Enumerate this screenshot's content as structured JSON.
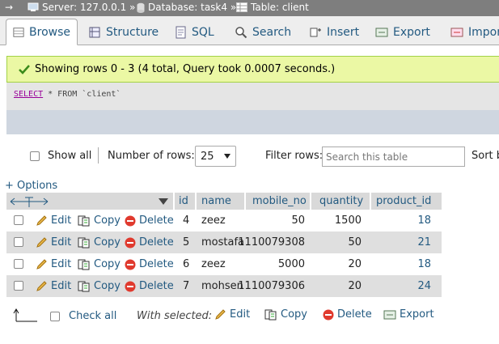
{
  "breadcrumb": {
    "arrow": "→",
    "server": "Server: 127.0.0.1 »",
    "database": "Database: task4 »",
    "table": "Table: client"
  },
  "tabs": [
    {
      "label": "Browse",
      "icon": "browse-icon"
    },
    {
      "label": "Structure",
      "icon": "structure-icon"
    },
    {
      "label": "SQL",
      "icon": "sql-icon"
    },
    {
      "label": "Search",
      "icon": "search-icon"
    },
    {
      "label": "Insert",
      "icon": "insert-icon"
    },
    {
      "label": "Export",
      "icon": "export-icon"
    },
    {
      "label": "Impor",
      "icon": "import-icon"
    }
  ],
  "success_message": "Showing rows 0 - 3 (4 total, Query took 0.0007 seconds.)",
  "sql": {
    "keyword": "SELECT",
    "rest": " * FROM `client`"
  },
  "nav": {
    "show_all": "Show all",
    "number_of_rows_label": "Number of rows:",
    "rows_value": "25",
    "filter_label": "Filter rows:",
    "filter_placeholder": "Search this table",
    "sort_label": "Sort b"
  },
  "options_link": "+ Options",
  "table": {
    "columns": [
      "id",
      "name",
      "mobile_no",
      "quantity",
      "product_id"
    ],
    "actions": {
      "edit": "Edit",
      "copy": "Copy",
      "delete": "Delete"
    },
    "rows": [
      {
        "id": "4",
        "name": "zeez",
        "mobile_no": "50",
        "quantity": "1500",
        "product_id": "18"
      },
      {
        "id": "5",
        "name": "mostafa",
        "mobile_no": "1110079308",
        "quantity": "50",
        "product_id": "21"
      },
      {
        "id": "6",
        "name": "zeez",
        "mobile_no": "5000",
        "quantity": "20",
        "product_id": "18"
      },
      {
        "id": "7",
        "name": "mohsen",
        "mobile_no": "1110079306",
        "quantity": "20",
        "product_id": "24"
      }
    ]
  },
  "footer": {
    "check_all": "Check all",
    "with_selected": "With selected:",
    "edit": "Edit",
    "copy": "Copy",
    "delete": "Delete",
    "export": "Export"
  },
  "colors": {
    "link": "#235a81",
    "success_bg": "#ebf8a4",
    "header_bg": "#d9d9d9"
  }
}
